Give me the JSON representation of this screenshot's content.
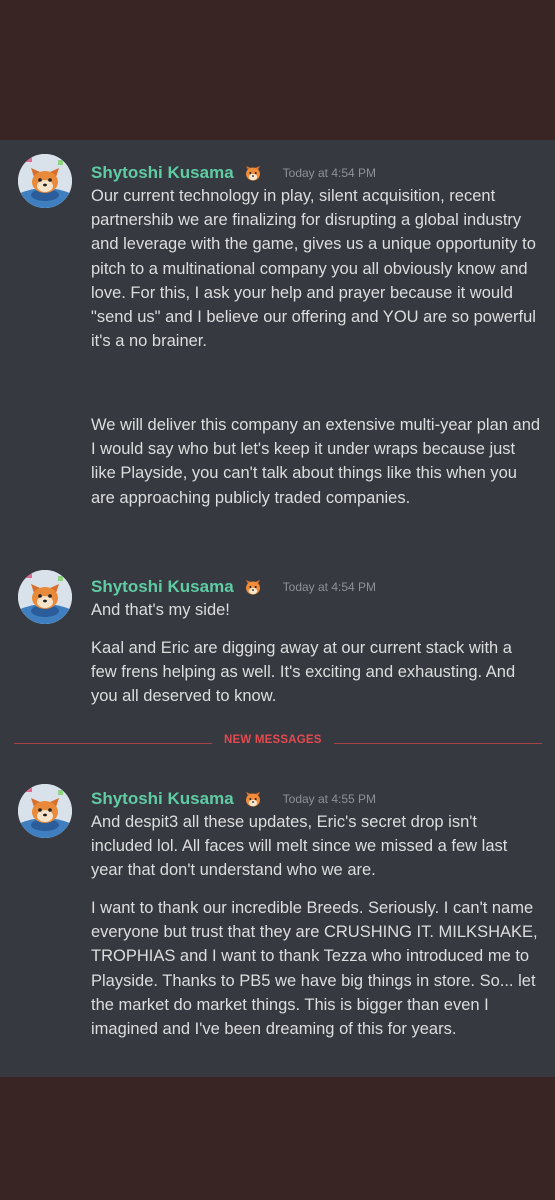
{
  "colors": {
    "background_frame": "#3a2525",
    "chat_background": "#36393f",
    "author_name": "#5fcca4",
    "message_text": "#dcddde",
    "timestamp": "#8e9297",
    "new_messages": "#e34a50"
  },
  "messages": [
    {
      "author": "Shytoshi Kusama",
      "timestamp": "Today at 4:54 PM",
      "badge_icon": "shiba-emoji-icon",
      "paragraphs": [
        "Our current technology in play, silent acquisition, recent partnershib we are finalizing for disrupting a global industry and leverage with the game, gives us a unique opportunity to pitch to a multinational company you all obviously know and love. For this, I ask your help and prayer because it would \"send us\" and I believe our offering and YOU are so powerful it's a no brainer.",
        "We will deliver this company an extensive multi-year plan and I would say who but let's keep it under wraps because just like Playside, you can't talk about things like this when you are approaching publicly traded companies."
      ]
    },
    {
      "author": "Shytoshi Kusama",
      "timestamp": "Today at 4:54 PM",
      "badge_icon": "shiba-emoji-icon",
      "paragraphs": [
        "And that's my side!",
        "Kaal and Eric are digging away at our current stack with a few frens helping as well. It's exciting and exhausting. And you all deserved to know."
      ]
    },
    {
      "author": "Shytoshi Kusama",
      "timestamp": "Today at 4:55 PM",
      "badge_icon": "shiba-emoji-icon",
      "paragraphs": [
        "And despit3 all these updates, Eric's secret drop isn't included lol. All faces will melt since we missed a few last year that don't understand who we are.",
        "I want to thank our incredible Breeds. Seriously. I can't name everyone but trust that they are CRUSHING IT. MILKSHAKE, TROPHIAS and I want to thank Tezza who introduced me to Playside. Thanks to PB5 we have big things in store. So... let the market do market things. This is bigger than even I imagined and I've been dreaming of this for years."
      ]
    }
  ],
  "divider": {
    "label": "NEW MESSAGES"
  }
}
